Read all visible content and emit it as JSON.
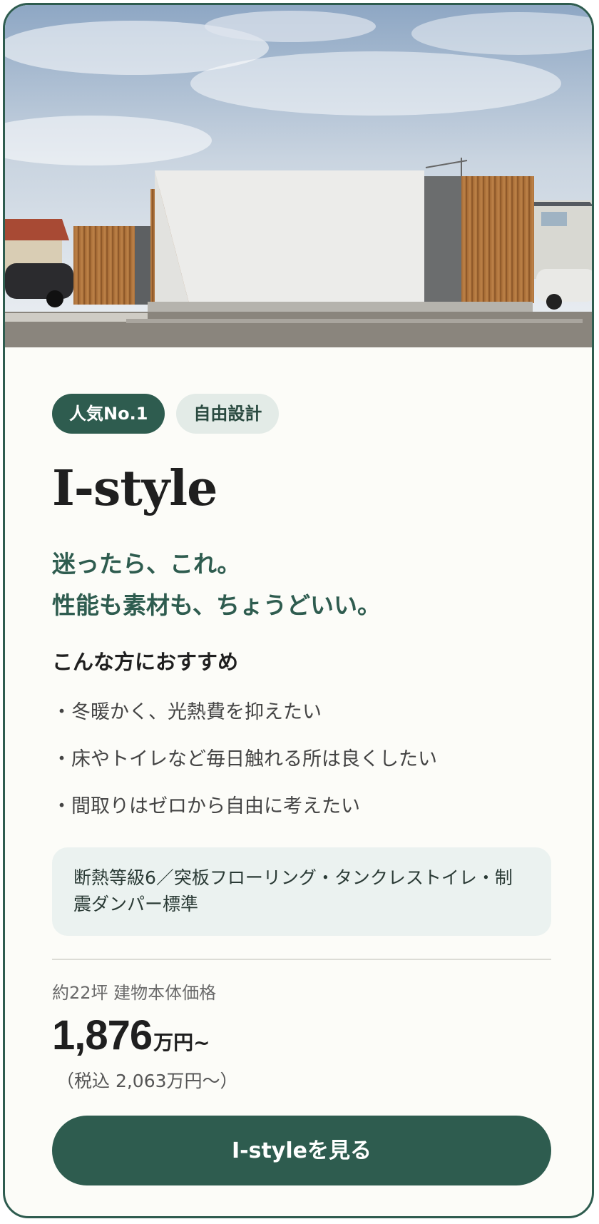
{
  "badges": {
    "primary": "人気No.1",
    "secondary": "自由設計"
  },
  "product": {
    "name": "I-style",
    "tagline_line1": "迷ったら、これ。",
    "tagline_line2": "性能も素材も、ちょうどいい。"
  },
  "recommend": {
    "heading": "こんな方におすすめ",
    "items": [
      "・冬暖かく、光熱費を抑えたい",
      "・床やトイレなど毎日触れる所は良くしたい",
      "・間取りはゼロから自由に考えたい"
    ]
  },
  "features": {
    "text": "断熱等級6／突板フローリング・タンクレストイレ・制震ダンパー標準"
  },
  "price": {
    "label": "約22坪 建物本体価格",
    "amount": "1,876",
    "unit": "万円~",
    "tax_included": "（税込 2,063万円〜）"
  },
  "cta": {
    "label": "I-styleを見る"
  },
  "colors": {
    "brand_green": "#2e5c4f",
    "card_background": "#fcfcf8",
    "feature_box": "#ebf2f0"
  },
  "hero": {
    "image": "house-photo"
  }
}
